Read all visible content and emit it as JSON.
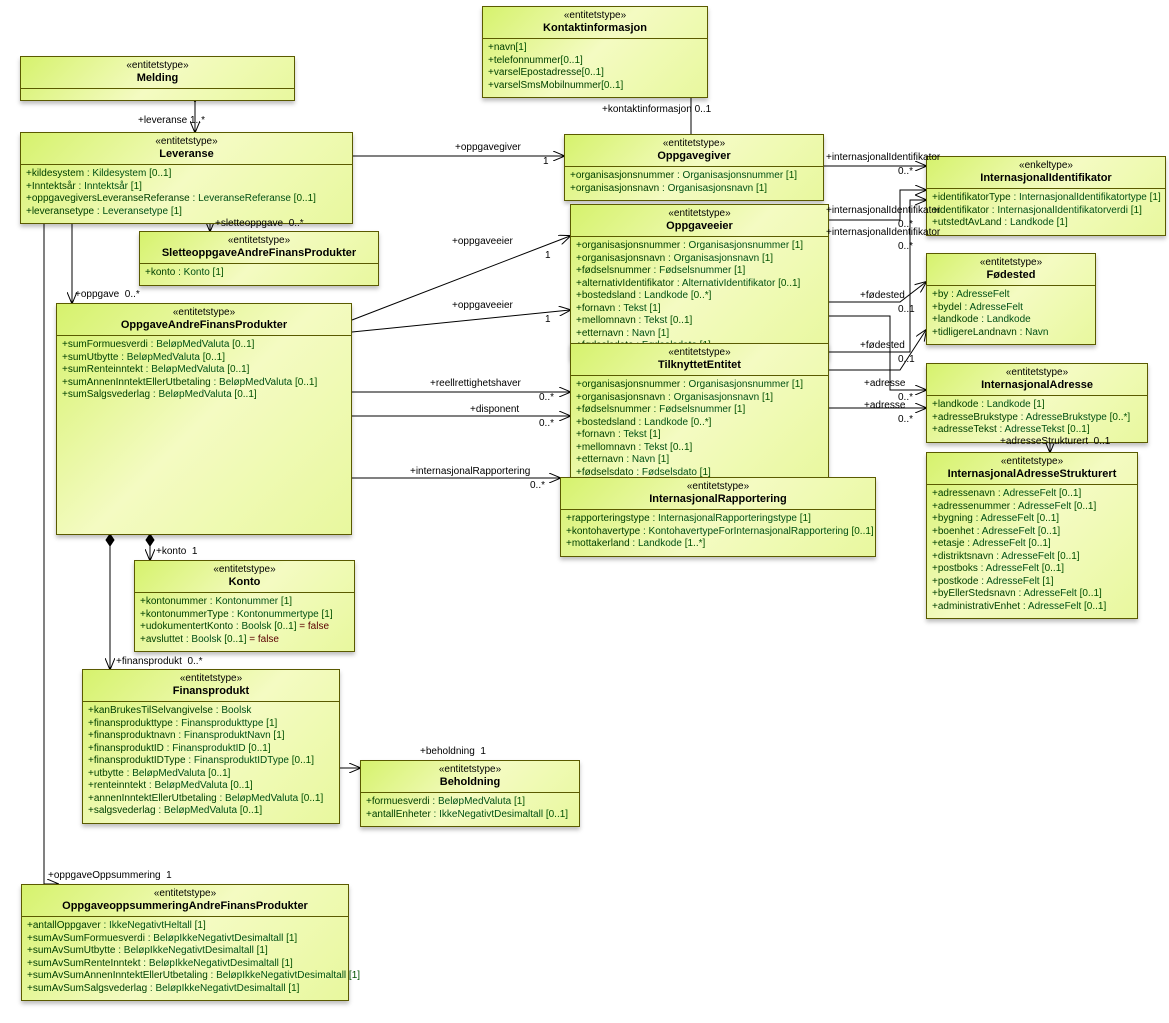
{
  "stereotype_entity": "«entitetstype»",
  "stereotype_simple": "«enkeltype»",
  "boxes": {
    "melding": {
      "title": "Melding"
    },
    "kontakt": {
      "title": "Kontaktinformasjon",
      "attrs": [
        {
          "n": "+navn",
          "t": "",
          "c": "[1]"
        },
        {
          "n": "+telefonnummer",
          "t": "",
          "c": "[0..1]"
        },
        {
          "n": "+varselEpostadresse",
          "t": "",
          "c": "[0..1]"
        },
        {
          "n": "+varselSmsMobilnummer",
          "t": "",
          "c": "[0..1]"
        }
      ]
    },
    "leveranse": {
      "title": "Leveranse",
      "attrs": [
        {
          "n": "+kildesystem",
          "t": " : Kildesystem",
          "c": " [0..1]"
        },
        {
          "n": "+Inntektsår",
          "t": " : Inntektsår",
          "c": " [1]"
        },
        {
          "n": "+oppgavegiversLeveranseReferanse",
          "t": " : LeveranseReferanse",
          "c": " [0..1]"
        },
        {
          "n": "+leveransetype",
          "t": " : Leveransetype",
          "c": " [1]"
        }
      ]
    },
    "oppgavegiver": {
      "title": "Oppgavegiver",
      "attrs": [
        {
          "n": "+organisasjonsnummer",
          "t": " : Organisasjonsnummer",
          "c": " [1]"
        },
        {
          "n": "+organisasjonsnavn",
          "t": " : Organisasjonsnavn",
          "c": " [1]"
        }
      ]
    },
    "sletteoppgave": {
      "title": "SletteoppgaveAndreFinansProdukter",
      "attrs": [
        {
          "n": "+konto",
          "t": " : Konto",
          "c": " [1]"
        }
      ]
    },
    "oppgaveeier": {
      "title": "Oppgaveeier",
      "attrs": [
        {
          "n": "+organisasjonsnummer",
          "t": " : Organisasjonsnummer",
          "c": " [1]"
        },
        {
          "n": "+organisasjonsnavn",
          "t": " : Organisasjonsnavn",
          "c": " [1]"
        },
        {
          "n": "+fødselsnummer",
          "t": " : Fødselsnummer",
          "c": " [1]"
        },
        {
          "n": "+alternativIdentifikator",
          "t": " : AlternativIdentifikator",
          "c": " [0..1]"
        },
        {
          "n": "+bostedsland",
          "t": " : Landkode",
          "c": " [0..*]"
        },
        {
          "n": "+fornavn",
          "t": " : Tekst",
          "c": " [1]"
        },
        {
          "n": "+mellomnavn",
          "t": " : Tekst",
          "c": " [0..1]"
        },
        {
          "n": "+etternavn",
          "t": " : Navn",
          "c": " [1]"
        },
        {
          "n": "+fødselsdato",
          "t": " : Fødselsdato",
          "c": " [1]"
        }
      ]
    },
    "internasjonalid": {
      "title": "InternasjonalIdentifikator",
      "attrs": [
        {
          "n": "+identifikatorType",
          "t": " : InternasjonalIdentifikatortype",
          "c": " [1]"
        },
        {
          "n": "+identifikator",
          "t": " : InternasjonalIdentifikatorverdi",
          "c": " [1]"
        },
        {
          "n": "+utstedtAvLand",
          "t": " : Landkode",
          "c": " [1]"
        }
      ]
    },
    "fodested": {
      "title": "Fødested",
      "attrs": [
        {
          "n": "+by",
          "t": " : AdresseFelt",
          "c": ""
        },
        {
          "n": "+bydel",
          "t": " : AdresseFelt",
          "c": ""
        },
        {
          "n": "+landkode",
          "t": " : Landkode",
          "c": ""
        },
        {
          "n": "+tidligereLandnavn",
          "t": " : Navn",
          "c": ""
        }
      ]
    },
    "oppgave": {
      "title": "OppgaveAndreFinansProdukter",
      "attrs": [
        {
          "n": "+sumFormuesverdi",
          "t": " : BeløpMedValuta",
          "c": " [0..1]"
        },
        {
          "n": "+sumUtbytte",
          "t": " : BeløpMedValuta",
          "c": " [0..1]"
        },
        {
          "n": "+sumRenteinntekt",
          "t": " : BeløpMedValuta",
          "c": " [0..1]"
        },
        {
          "n": "+sumAnnenInntektEllerUtbetaling",
          "t": " : BeløpMedValuta",
          "c": " [0..1]"
        },
        {
          "n": "+sumSalgsvederlag",
          "t": " : BeløpMedValuta",
          "c": " [0..1]"
        }
      ]
    },
    "tilknyttet": {
      "title": "TilknyttetEntitet",
      "attrs": [
        {
          "n": "+organisasjonsnummer",
          "t": " : Organisasjonsnummer",
          "c": " [1]"
        },
        {
          "n": "+organisasjonsnavn",
          "t": " : Organisasjonsnavn",
          "c": " [1]"
        },
        {
          "n": "+fødselsnummer",
          "t": " : Fødselsnummer",
          "c": " [1]"
        },
        {
          "n": "+bostedsland",
          "t": " : Landkode",
          "c": " [0..*]"
        },
        {
          "n": "+fornavn",
          "t": " : Tekst",
          "c": " [1]"
        },
        {
          "n": "+mellomnavn",
          "t": " : Tekst",
          "c": " [0..1]"
        },
        {
          "n": "+etternavn",
          "t": " : Navn",
          "c": " [1]"
        },
        {
          "n": "+fødselsdato",
          "t": " : Fødselsdato",
          "c": " [1]"
        }
      ]
    },
    "intadr": {
      "title": "InternasjonalAdresse",
      "attrs": [
        {
          "n": "+landkode",
          "t": " : Landkode",
          "c": " [1]"
        },
        {
          "n": "+adresseBrukstype",
          "t": " : AdresseBrukstype",
          "c": " [0..*]"
        },
        {
          "n": "+adresseTekst",
          "t": " : AdresseTekst",
          "c": " [0..1]"
        }
      ]
    },
    "intadrstr": {
      "title": "InternasjonalAdresseStrukturert",
      "attrs": [
        {
          "n": "+adressenavn",
          "t": " : AdresseFelt",
          "c": " [0..1]"
        },
        {
          "n": "+adressenummer",
          "t": " : AdresseFelt",
          "c": " [0..1]"
        },
        {
          "n": "+bygning",
          "t": " : AdresseFelt",
          "c": " [0..1]"
        },
        {
          "n": "+boenhet",
          "t": " : AdresseFelt",
          "c": " [0..1]"
        },
        {
          "n": "+etasje",
          "t": " : AdresseFelt",
          "c": " [0..1]"
        },
        {
          "n": "+distriktsnavn",
          "t": " : AdresseFelt",
          "c": " [0..1]"
        },
        {
          "n": "+postboks",
          "t": " : AdresseFelt",
          "c": " [0..1]"
        },
        {
          "n": "+postkode",
          "t": " : AdresseFelt",
          "c": " [1]"
        },
        {
          "n": "+byEllerStedsnavn",
          "t": " : AdresseFelt",
          "c": " [0..1]"
        },
        {
          "n": "+administrativEnhet",
          "t": " : AdresseFelt",
          "c": " [0..1]"
        }
      ]
    },
    "intrap": {
      "title": "InternasjonalRapportering",
      "attrs": [
        {
          "n": "+rapporteringstype",
          "t": " : InternasjonalRapporteringstype",
          "c": " [1]"
        },
        {
          "n": "+kontohavertype",
          "t": " : KontohavertypeForInternasjonalRapportering",
          "c": " [0..1]"
        },
        {
          "n": "+mottakerland",
          "t": " : Landkode",
          "c": " [1..*]"
        }
      ]
    },
    "konto": {
      "title": "Konto",
      "attrs": [
        {
          "n": "+kontonummer",
          "t": " : Kontonummer",
          "c": " [1]"
        },
        {
          "n": "+kontonummerType",
          "t": " : Kontonummertype",
          "c": " [1]"
        },
        {
          "n": "+udokumentertKonto",
          "t": " : Boolsk",
          "c": " [0..1]",
          "d": " = false"
        },
        {
          "n": "+avsluttet",
          "t": " : Boolsk",
          "c": " [0..1]",
          "d": " = false"
        }
      ]
    },
    "finans": {
      "title": "Finansprodukt",
      "attrs": [
        {
          "n": "+kanBrukesTilSelvangivelse",
          "t": " : Boolsk",
          "c": ""
        },
        {
          "n": "+finansprodukttype",
          "t": " : Finansprodukttype",
          "c": " [1]"
        },
        {
          "n": "+finansproduktnavn",
          "t": " : FinansproduktNavn",
          "c": " [1]"
        },
        {
          "n": "+finansproduktID",
          "t": " : FinansproduktID",
          "c": " [0..1]"
        },
        {
          "n": "+finansproduktIDType",
          "t": " : FinansproduktIDType",
          "c": " [0..1]"
        },
        {
          "n": "+utbytte",
          "t": " : BeløpMedValuta",
          "c": " [0..1]"
        },
        {
          "n": "+renteinntekt",
          "t": " : BeløpMedValuta",
          "c": " [0..1]"
        },
        {
          "n": "+annenInntektEllerUtbetaling",
          "t": " : BeløpMedValuta",
          "c": " [0..1]"
        },
        {
          "n": "+salgsvederlag",
          "t": " : BeløpMedValuta",
          "c": " [0..1]"
        }
      ]
    },
    "behold": {
      "title": "Beholdning",
      "attrs": [
        {
          "n": "+formuesverdi",
          "t": " : BeløpMedValuta",
          "c": " [1]"
        },
        {
          "n": "+antallEnheter",
          "t": " : IkkeNegativtDesimaltall",
          "c": " [0..1]"
        }
      ]
    },
    "oppsum": {
      "title": "OppgaveoppsummeringAndreFinansProdukter",
      "attrs": [
        {
          "n": "+antallOppgaver",
          "t": " : IkkeNegativtHeltall",
          "c": " [1]"
        },
        {
          "n": "+sumAvSumFormuesverdi",
          "t": " : BeløpIkkeNegativtDesimaltall",
          "c": " [1]"
        },
        {
          "n": "+sumAvSumUtbytte",
          "t": " : BeløpIkkeNegativtDesimaltall",
          "c": " [1]"
        },
        {
          "n": "+sumAvSumRenteInntekt",
          "t": " : BeløpIkkeNegativtDesimaltall",
          "c": " [1]"
        },
        {
          "n": "+sumAvSumAnnenInntektEllerUtbetaling",
          "t": " : BeløpIkkeNegativtDesimaltall",
          "c": " [1]"
        },
        {
          "n": "+sumAvSumSalgsvederlag",
          "t": " : BeløpIkkeNegativtDesimaltall",
          "c": " [1]"
        }
      ]
    }
  },
  "labels": {
    "lev": "+leveranse",
    "lev_c": "1..*",
    "slette": "+sletteoppgave",
    "slette_c": "0..*",
    "oppgavegiver": "+oppgavegiver",
    "one": "1",
    "kontaktinfo": "+kontaktinformasjon",
    "kontakt_c": "0..1",
    "oppgave": "+oppgave",
    "oppgave_c": "0..*",
    "oppgaveeier": "+oppgaveeier",
    "reell": "+reellrettighetshaver",
    "disponent": "+disponent",
    "intid": "+internasjonalIdentifikator",
    "zerostar": "0..*",
    "fodested": "+fødested",
    "zeroone": "0..1",
    "adresse": "+adresse",
    "adresseStr": "+adresseStrukturert",
    "intrap": "+internasjonalRapportering",
    "konto": "+konto",
    "finans": "+finansprodukt",
    "behold": "+beholdning",
    "oppsum": "+oppgaveOppsummering"
  }
}
